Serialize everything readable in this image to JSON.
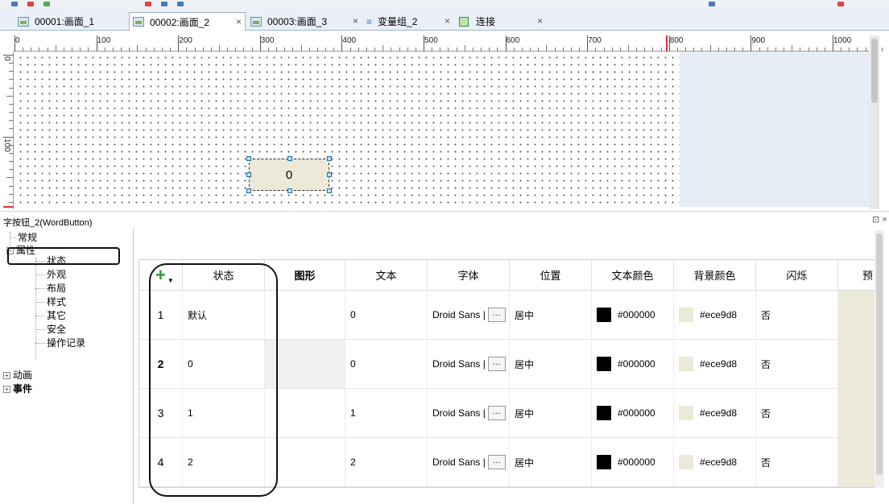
{
  "tabs": [
    {
      "label": "00001:画面_1"
    },
    {
      "label": "00002:画面_2"
    },
    {
      "label": "00003:画面_3"
    },
    {
      "label": "变量组_2"
    },
    {
      "label": "连接"
    }
  ],
  "tab_close_glyph": "×",
  "ruler": {
    "horizontal": [
      "0",
      "100",
      "200",
      "300",
      "400",
      "500",
      "600",
      "700",
      "800",
      "900",
      "1000"
    ],
    "vertical": [
      "0",
      "100"
    ]
  },
  "canvas": {
    "word_button_value": "0"
  },
  "properties": {
    "title": "字按钮_2(WordButton)",
    "window_controls": "⊡ ×",
    "tree": {
      "general": "常规",
      "properties": "属性",
      "children": [
        "状态",
        "外观",
        "布局",
        "样式",
        "其它",
        "安全",
        "操作记录"
      ],
      "animation": "动画",
      "events": "事件"
    }
  },
  "table": {
    "add_icon": "+",
    "columns": [
      "状态",
      "图形",
      "文本",
      "字体",
      "位置",
      "文本颜色",
      "背景颜色",
      "闪烁",
      "预"
    ],
    "rows": [
      {
        "num": "1",
        "state": "默认",
        "graphic": "",
        "text": "0",
        "font": "Droid Sans |",
        "pos": "居中",
        "text_color": "#000000",
        "bg_color": "#ece9d8",
        "blink": "否"
      },
      {
        "num": "2",
        "state": "0",
        "graphic": "",
        "text": "0",
        "font": "Droid Sans |",
        "pos": "居中",
        "text_color": "#000000",
        "bg_color": "#ece9d8",
        "blink": "否"
      },
      {
        "num": "3",
        "state": "1",
        "graphic": "",
        "text": "1",
        "font": "Droid Sans |",
        "pos": "居中",
        "text_color": "#000000",
        "bg_color": "#ece9d8",
        "blink": "否"
      },
      {
        "num": "4",
        "state": "2",
        "graphic": "",
        "text": "2",
        "font": "Droid Sans |",
        "pos": "居中",
        "text_color": "#000000",
        "bg_color": "#ece9d8",
        "blink": "否"
      }
    ],
    "font_button": "…"
  },
  "colors": {
    "text_color_swatch": "#000000",
    "bg_color_swatch": "#ece9d8",
    "selection_handle": "#1d6fa5"
  }
}
